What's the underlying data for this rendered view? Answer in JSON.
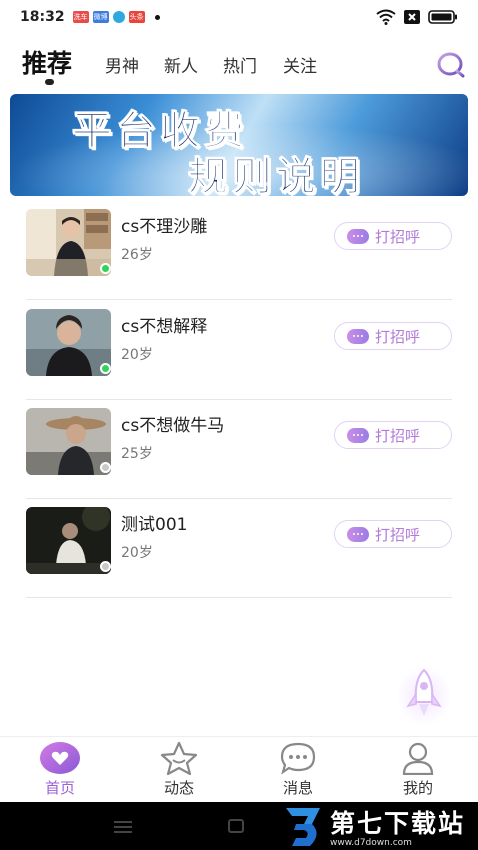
{
  "status_bar": {
    "time": "18:32",
    "app_icons": [
      {
        "label": "洗车",
        "color": "#e94b4b"
      },
      {
        "label": "微博",
        "color": "#3d7be0"
      },
      {
        "label": "",
        "color": "#2fa8e0"
      },
      {
        "label": "头条",
        "color": "#e9453d"
      }
    ],
    "icons": [
      "wifi-icon",
      "sim-icon",
      "battery-icon"
    ]
  },
  "tabs": [
    {
      "label": "推荐",
      "active": true
    },
    {
      "label": "男神",
      "active": false
    },
    {
      "label": "新人",
      "active": false
    },
    {
      "label": "热门",
      "active": false
    },
    {
      "label": "关注",
      "active": false
    }
  ],
  "banner": {
    "line1": "平台收费",
    "line2": "规则说明"
  },
  "users": [
    {
      "name": "cs不理沙雕",
      "age": "26岁",
      "online": true,
      "greet_label": "打招呼"
    },
    {
      "name": "cs不想解释",
      "age": "20岁",
      "online": true,
      "greet_label": "打招呼"
    },
    {
      "name": "cs不想做牛马",
      "age": "25岁",
      "online": false,
      "greet_label": "打招呼"
    },
    {
      "name": "测试001",
      "age": "20岁",
      "online": false,
      "greet_label": "打招呼"
    }
  ],
  "colors": {
    "accent": "#9e5fd8",
    "online": "#2fd35a",
    "offline": "#c9c9c9"
  },
  "nav": [
    {
      "label": "首页",
      "icon": "heart-icon",
      "active": true
    },
    {
      "label": "动态",
      "icon": "star-icon",
      "active": false
    },
    {
      "label": "消息",
      "icon": "chat-icon",
      "active": false
    },
    {
      "label": "我的",
      "icon": "profile-icon",
      "active": false
    }
  ],
  "watermark": {
    "title": "第七下载站",
    "url": "www.d7down.com"
  }
}
